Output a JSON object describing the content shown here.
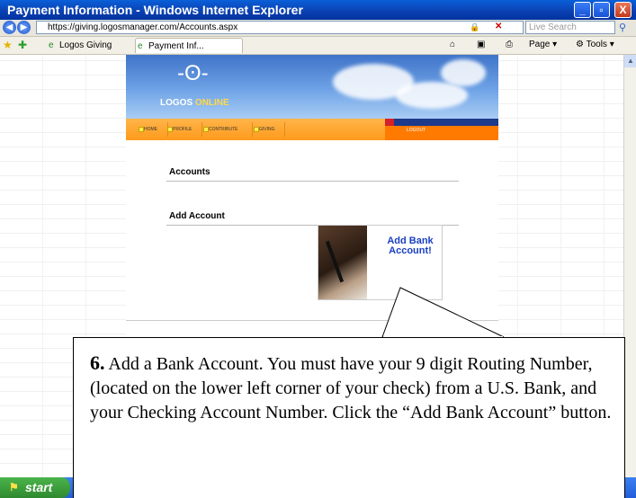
{
  "window": {
    "title": "Payment Information - Windows Internet Explorer",
    "min_label": "_",
    "max_label": "▫",
    "close_label": "X"
  },
  "addressbar": {
    "url": "https://giving.logosmanager.com/Accounts.aspx",
    "search_placeholder": "Live Search"
  },
  "tabs": {
    "favorite_label": "Logos Giving",
    "active_tab_label": "Payment Inf...",
    "page_label": "Page",
    "tools_label": "Tools"
  },
  "site": {
    "logo_main": "LOGOS",
    "logo_sub": "ONLINE",
    "nav": [
      "HOME",
      "PROFILE",
      "CONTRIBUTE",
      "GIVING"
    ],
    "logout_label": "LOGOUT",
    "accounts_heading": "Accounts",
    "add_account_heading": "Add Account",
    "add_bank_button_label": "Add Bank Account!"
  },
  "taskbar": {
    "start_label": "start"
  },
  "callout": {
    "step_number": "6.",
    "text": " Add a Bank Account.  You must have your 9 digit Routing Number, (located on the lower left corner of your check) from a U.S. Bank, and your Checking Account Number.  Click the “Add Bank Account” button."
  },
  "colors": {
    "titlebar": "#0a3fb0",
    "nav_orange": "#ff9a1c",
    "bank_link": "#1a3fc2"
  }
}
